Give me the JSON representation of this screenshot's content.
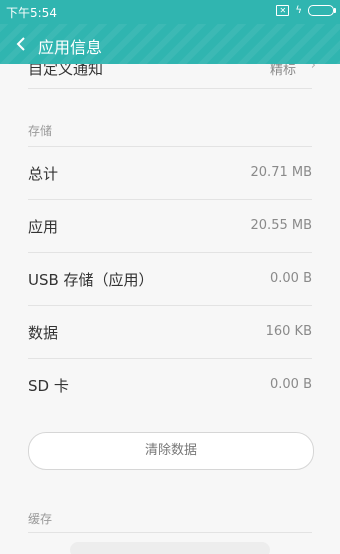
{
  "status_bar": {
    "time": "下午5:54",
    "colors": {
      "background": "#30b5b0"
    }
  },
  "app_bar": {
    "title": "应用信息",
    "back_icon": "chevron-left-icon"
  },
  "partial_row": {
    "label": "自定义通知",
    "value": "精标"
  },
  "storage": {
    "section_title": "存储",
    "rows": [
      {
        "label": "总计",
        "value": "20.71 MB"
      },
      {
        "label": "应用",
        "value": "20.55 MB"
      },
      {
        "label": "USB 存储（应用）",
        "value": "0.00 B"
      },
      {
        "label": "数据",
        "value": "160 KB"
      },
      {
        "label": "SD 卡",
        "value": "0.00 B"
      }
    ],
    "clear_button": "清除数据"
  },
  "cache": {
    "section_title": "缓存"
  }
}
